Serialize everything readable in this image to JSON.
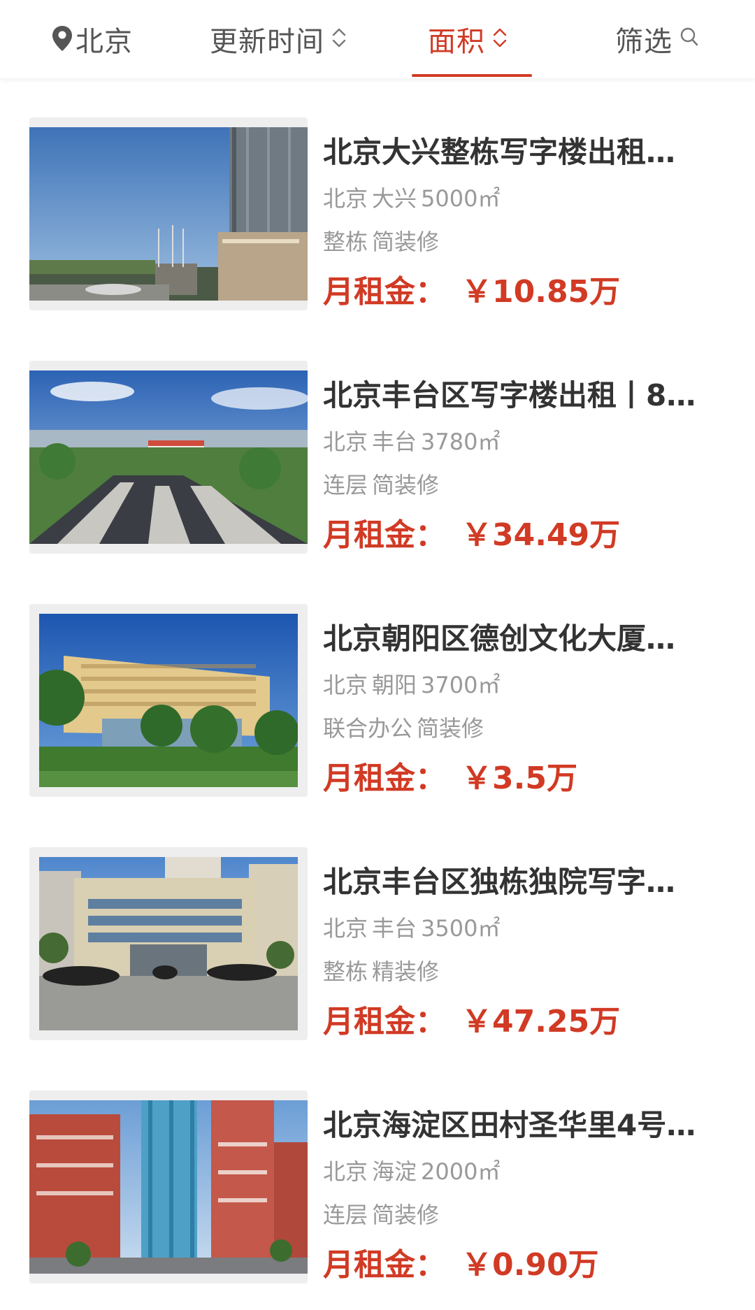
{
  "filter_bar": {
    "location": "北京",
    "sort_time": "更新时间",
    "sort_area": "面积",
    "filter": "筛选",
    "active_color": "#d13a24"
  },
  "listings": [
    {
      "title": "北京大兴整栋写字楼出租…",
      "city": "北京",
      "district": "大兴",
      "area": "5000㎡",
      "layout": "整栋",
      "decoration": "简装修",
      "price_label": "月租金：",
      "price": "￥10.85万"
    },
    {
      "title": "北京丰台区写字楼出租丨8…",
      "city": "北京",
      "district": "丰台",
      "area": "3780㎡",
      "layout": "连层",
      "decoration": "简装修",
      "price_label": "月租金：",
      "price": "￥34.49万"
    },
    {
      "title": "北京朝阳区德创文化大厦…",
      "city": "北京",
      "district": "朝阳",
      "area": "3700㎡",
      "layout": "联合办公",
      "decoration": "简装修",
      "price_label": "月租金：",
      "price": "￥3.5万"
    },
    {
      "title": "北京丰台区独栋独院写字…",
      "city": "北京",
      "district": "丰台",
      "area": "3500㎡",
      "layout": "整栋",
      "decoration": "精装修",
      "price_label": "月租金：",
      "price": "￥47.25万"
    },
    {
      "title": "北京海淀区田村圣华里4号…",
      "city": "北京",
      "district": "海淀",
      "area": "2000㎡",
      "layout": "连层",
      "decoration": "简装修",
      "price_label": "月租金：",
      "price": "￥0.90万"
    }
  ]
}
